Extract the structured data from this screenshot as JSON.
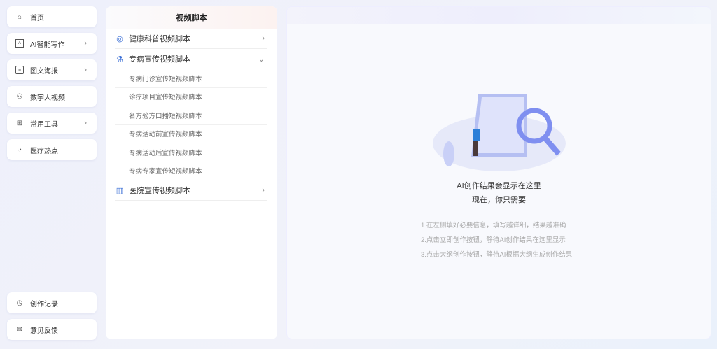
{
  "sidebar": {
    "items": [
      {
        "label": "首页",
        "icon": "home-icon"
      },
      {
        "label": "AI智能写作",
        "icon": "ai-doc-icon"
      },
      {
        "label": "图文海报",
        "icon": "poster-icon"
      },
      {
        "label": "数字人视频",
        "icon": "person-icon"
      },
      {
        "label": "常用工具",
        "icon": "grid-icon"
      },
      {
        "label": "医疗热点",
        "icon": "hot-icon"
      }
    ],
    "bottom": [
      {
        "label": "创作记录",
        "icon": "clock-icon"
      },
      {
        "label": "意见反馈",
        "icon": "feedback-icon"
      }
    ]
  },
  "menu": {
    "title": "视频脚本",
    "categories": [
      {
        "label": "健康科普视频脚本"
      },
      {
        "label": "专病宣传视频脚本",
        "items": [
          "专病门诊宣传短视频脚本",
          "诊疗项目宣传短视频脚本",
          "名方验方口播短视频脚本",
          "专病活动前宣传视频脚本",
          "专病活动后宣传视频脚本",
          "专病专家宣传短视频脚本"
        ]
      },
      {
        "label": "医院宣传视频脚本"
      }
    ]
  },
  "result": {
    "title": "AI创作结果会显示在这里",
    "subtitle": "现在，你只需要",
    "tips": [
      "1.在左侧填好必要信息，填写越详细，结果越准确",
      "2.点击立即创作按钮，静待AI创作结果在这里显示",
      "3.点击大纲创作按钮，静待AI根据大纲生成创作结果"
    ]
  }
}
